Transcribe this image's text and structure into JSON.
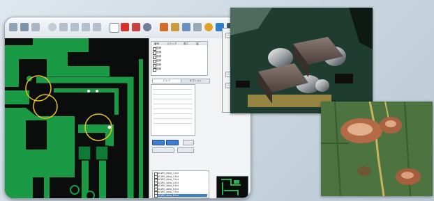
{
  "panel": {
    "table_headers": [
      "番号",
      "ステップ",
      "長さ",
      "幅"
    ],
    "table_rows": [
      {
        "a": "配線",
        "b": "",
        "c": "",
        "d": ""
      },
      {
        "a": "配線",
        "b": "",
        "c": "",
        "d": ""
      },
      {
        "a": "配線",
        "b": "",
        "c": "",
        "d": ""
      },
      {
        "a": "配線",
        "b": "",
        "c": "",
        "d": ""
      },
      {
        "a": "配線",
        "b": "",
        "c": "",
        "d": ""
      },
      {
        "a": "配線",
        "b": "",
        "c": "",
        "d": ""
      }
    ],
    "tabs": [
      "パッド",
      "オプション"
    ],
    "file_items": [
      "ACWS_data_1.txt",
      "ACWS_data_2.txt",
      "ACWS_data_3.txt",
      "ACWS_data_4.txt",
      "ACWS_data_5.txt",
      "ACWS_data_6.txt",
      "ACWS_data_7.txt",
      "ACWS_data_8.txt"
    ]
  },
  "overlay": {
    "ok_label": "OK",
    "cancel_label": "キャンセル"
  },
  "colors": {
    "pcb_copper": "#1a9a45",
    "pcb_background": "#0b0d0c",
    "highlight_circle": "#e8c21e",
    "accent_button": "#3f7fd2"
  }
}
